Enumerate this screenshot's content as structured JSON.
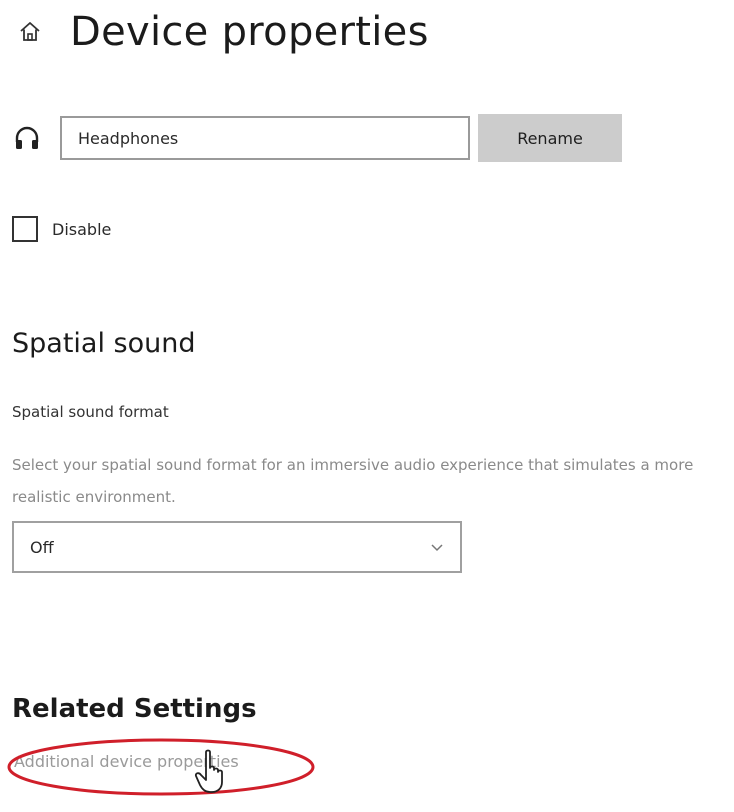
{
  "header": {
    "title": "Device properties",
    "home_icon": "home-icon"
  },
  "device": {
    "icon": "headphones-icon",
    "name_value": "Headphones",
    "rename_label": "Rename",
    "disable_label": "Disable",
    "disable_checked": false
  },
  "spatial": {
    "title": "Spatial sound",
    "format_label": "Spatial sound format",
    "format_description": "Select your spatial sound format for an immersive audio experience that simulates a more realistic environment.",
    "selected_format": "Off"
  },
  "related": {
    "title": "Related Settings",
    "link_label": "Additional device properties"
  },
  "colors": {
    "highlight": "#d01f2a",
    "button_bg": "#cccccc",
    "link": "#9a9a9a"
  }
}
